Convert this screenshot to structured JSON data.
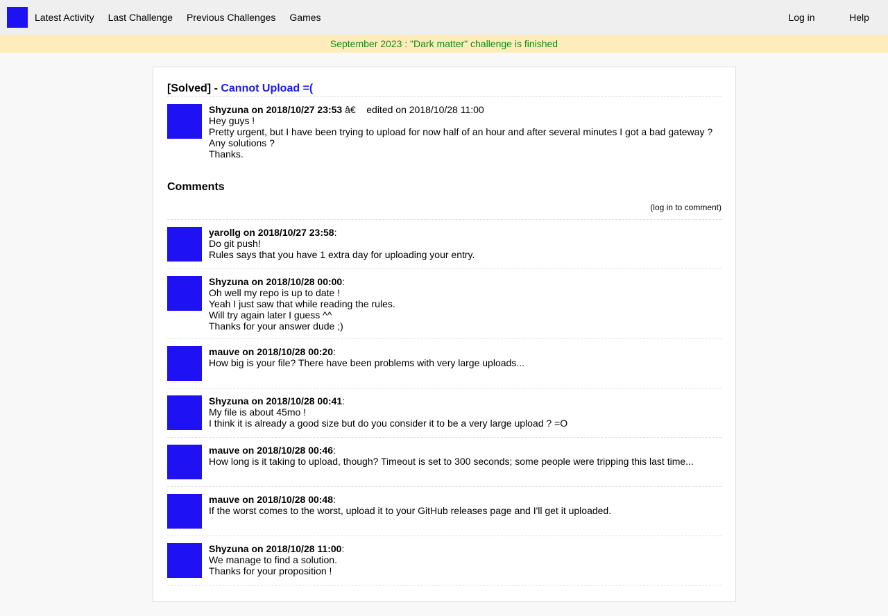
{
  "nav": {
    "items": [
      "Latest Activity",
      "Last Challenge",
      "Previous Challenges",
      "Games"
    ],
    "login": "Log in",
    "help": "Help",
    "logo_color": "#1e12f5"
  },
  "banner": "September 2023 : \"Dark matter\" challenge is finished",
  "post": {
    "status": "[Solved] - ",
    "title": "Cannot Upload =(",
    "author": "Shyzuna on 2018/10/27 23:53",
    "sep": " â€    ",
    "edited": "edited on 2018/10/28 11:00",
    "lines": [
      "Hey guys !",
      "Pretty urgent, but I have been trying to upload for now half of an hour and after several minutes I got a bad gateway ?",
      "Any solutions ?",
      "Thanks."
    ]
  },
  "comments_heading": "Comments",
  "login_to_comment": "(log in to comment)",
  "comments": [
    {
      "author": "yarollg on 2018/10/27 23:58",
      "lines": [
        "Do git push!",
        "Rules says that you have 1 extra day for uploading your entry."
      ]
    },
    {
      "author": "Shyzuna on 2018/10/28 00:00",
      "lines": [
        "Oh well my repo is up to date !",
        "Yeah I just saw that while reading the rules.",
        "Will try again later I guess ^^",
        "Thanks for your answer dude ;)"
      ]
    },
    {
      "author": "mauve on 2018/10/28 00:20",
      "lines": [
        "How big is your file? There have been problems with very large uploads..."
      ]
    },
    {
      "author": "Shyzuna on 2018/10/28 00:41",
      "lines": [
        "My file is about 45mo !",
        "I think it is already a good size but do you consider it to be a very large upload ? =O"
      ]
    },
    {
      "author": "mauve on 2018/10/28 00:46",
      "lines": [
        "How long is it taking to upload, though? Timeout is set to 300 seconds; some people were tripping this last time..."
      ]
    },
    {
      "author": "mauve on 2018/10/28 00:48",
      "lines": [
        "If the worst comes to the worst, upload it to your GitHub releases page and I'll get it uploaded."
      ]
    },
    {
      "author": "Shyzuna on 2018/10/28 11:00",
      "lines": [
        "We manage to find a solution.",
        "Thanks for your proposition !"
      ]
    }
  ]
}
